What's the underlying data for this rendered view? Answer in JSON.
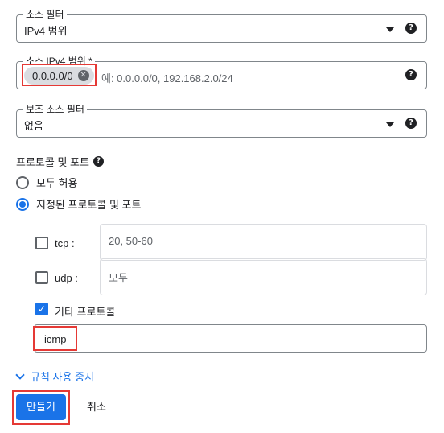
{
  "source_filter": {
    "label": "소스 필터",
    "value": "IPv4 범위"
  },
  "source_ipv4": {
    "label": "소스 IPv4 범위 *",
    "chip": "0.0.0.0/0",
    "placeholder": "예: 0.0.0.0/0, 192.168.2.0/24"
  },
  "secondary_filter": {
    "label": "보조 소스 필터",
    "value": "없음"
  },
  "protocols": {
    "title": "프로토콜 및 포트",
    "option_all": "모두 허용",
    "option_specified": "지정된 프로토콜 및 포트",
    "tcp_label": "tcp :",
    "tcp_placeholder": "20, 50-60",
    "udp_label": "udp :",
    "udp_placeholder": "모두",
    "other_label": "기타 프로토콜",
    "other_value": "icmp"
  },
  "links": {
    "disable_rule": "규칙 사용 중지"
  },
  "actions": {
    "create": "만들기",
    "cancel": "취소"
  },
  "help_glyph": "?",
  "remove_glyph": "✕",
  "check_glyph": "✓",
  "colors": {
    "accent": "#1a73e8",
    "highlight": "#e53935"
  }
}
